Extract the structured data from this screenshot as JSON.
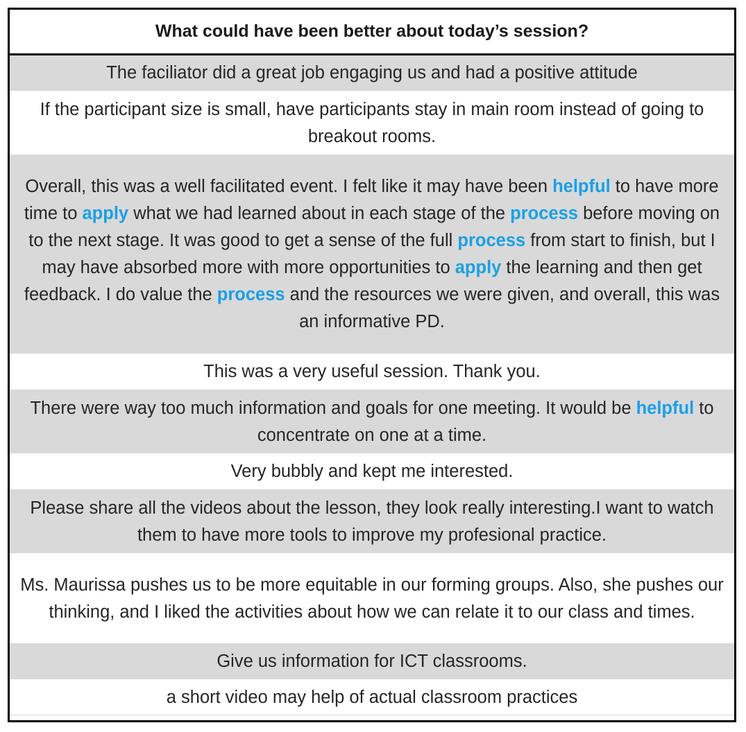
{
  "table": {
    "header": "What could have been better about today’s session?",
    "keyword_color": "#1aa0e6",
    "rows": [
      {
        "segments": [
          {
            "t": "The faciliator did a great job engaging us and had a positive attitude"
          }
        ]
      },
      {
        "segments": [
          {
            "t": "If the participant size is small, have participants stay in main room instead of going to breakout rooms."
          }
        ]
      },
      {
        "segments": [
          {
            "t": "Overall, this was a well facilitated event. I felt like it may have been "
          },
          {
            "t": "helpful",
            "kw": true
          },
          {
            "t": " to have more time to "
          },
          {
            "t": "apply",
            "kw": true
          },
          {
            "t": " what we had learned about in each stage of the "
          },
          {
            "t": "process",
            "kw": true
          },
          {
            "t": " before moving on to the next stage. It was good to get a sense of the full "
          },
          {
            "t": "process",
            "kw": true
          },
          {
            "t": " from start to finish, but I may have absorbed more with more opportunities to "
          },
          {
            "t": "apply",
            "kw": true
          },
          {
            "t": " the learning and then get feedback. I do value the "
          },
          {
            "t": "process",
            "kw": true
          },
          {
            "t": " and the resources we were given, and overall, this was an informative PD."
          }
        ]
      },
      {
        "segments": [
          {
            "t": "This was a very useful session. Thank you."
          }
        ]
      },
      {
        "segments": [
          {
            "t": "There were way too much information and goals for one meeting. It would be "
          },
          {
            "t": "helpful",
            "kw": true
          },
          {
            "t": " to concentrate on one at a time."
          }
        ]
      },
      {
        "segments": [
          {
            "t": "Very bubbly and kept me interested."
          }
        ]
      },
      {
        "segments": [
          {
            "t": "Please share all the videos about the lesson, they look really interesting.I want to watch them to have more tools to improve my profesional practice."
          }
        ]
      },
      {
        "segments": [
          {
            "t": "Ms. Maurissa pushes us to be more equitable in our forming groups. Also, she pushes our thinking, and I liked the activities about how we can relate it to our class and times."
          }
        ]
      },
      {
        "segments": [
          {
            "t": "Give us information for ICT classrooms."
          }
        ]
      },
      {
        "segments": [
          {
            "t": "a short video may help of actual classroom practices"
          }
        ]
      }
    ]
  }
}
